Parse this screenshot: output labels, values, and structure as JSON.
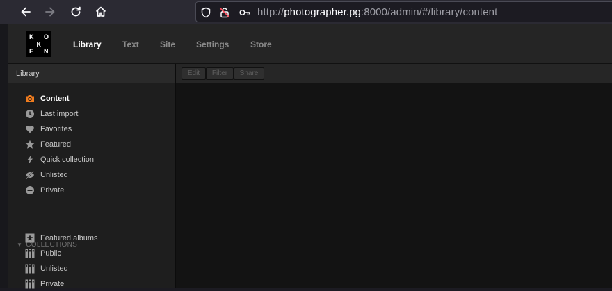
{
  "browser": {
    "url_prefix": "http://",
    "url_host": "photographer.pg",
    "url_rest": ":8000/admin/#/library/content"
  },
  "app": {
    "logo_letters": [
      "K",
      "O",
      "K",
      "E",
      "N"
    ],
    "nav": [
      {
        "label": "Library",
        "active": true
      },
      {
        "label": "Text",
        "active": false
      },
      {
        "label": "Site",
        "active": false
      },
      {
        "label": "Settings",
        "active": false
      },
      {
        "label": "Store",
        "active": false
      }
    ]
  },
  "sidebar": {
    "header": "Library",
    "items": [
      {
        "label": "Content",
        "icon": "camera-icon"
      },
      {
        "label": "Last import",
        "icon": "clock-icon"
      },
      {
        "label": "Favorites",
        "icon": "heart-icon"
      },
      {
        "label": "Featured",
        "icon": "star-icon"
      },
      {
        "label": "Quick collection",
        "icon": "lightning-icon"
      },
      {
        "label": "Unlisted",
        "icon": "eye-slash-icon"
      },
      {
        "label": "Private",
        "icon": "minus-circle-icon"
      }
    ],
    "collections_label": "COLLECTIONS",
    "collections": [
      {
        "label": "Featured albums",
        "icon": "featured-album-icon"
      },
      {
        "label": "Public",
        "icon": "album-icon"
      },
      {
        "label": "Unlisted",
        "icon": "album-icon"
      },
      {
        "label": "Private",
        "icon": "album-icon"
      }
    ]
  },
  "toolbar": {
    "edit_label": "Edit",
    "filter_label": "Filter",
    "share_label": "Share"
  },
  "colors": {
    "accent": "#f07c1e"
  }
}
